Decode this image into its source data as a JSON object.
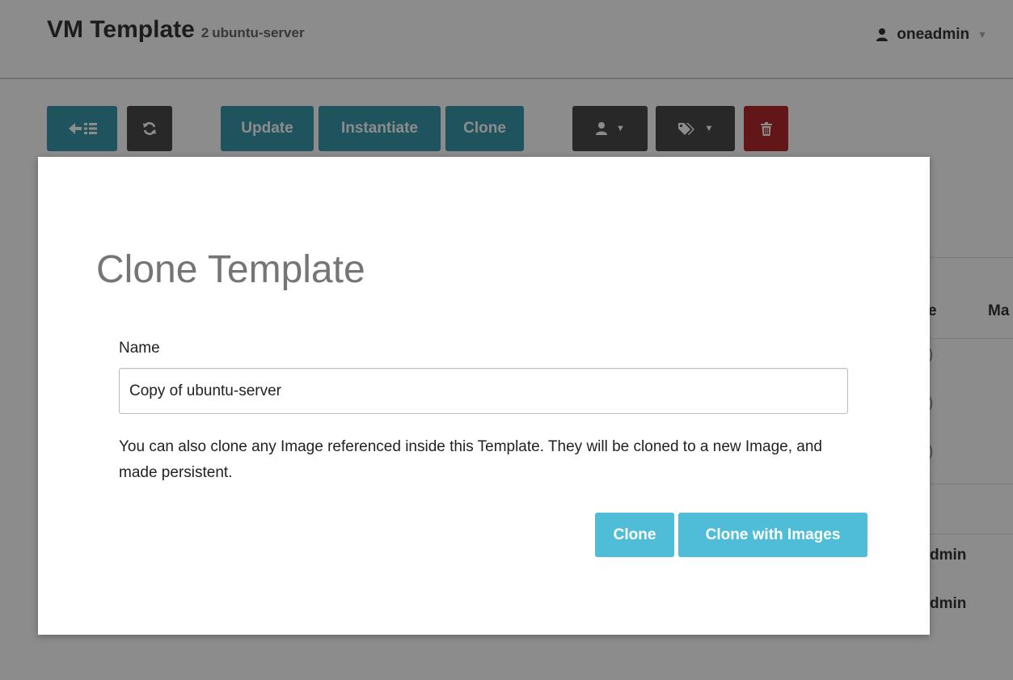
{
  "header": {
    "title": "VM Template",
    "template_id": "2",
    "template_name": "ubuntu-server",
    "user": "oneadmin",
    "user_icon": "user-icon",
    "caret_icon": "caret-down-icon"
  },
  "toolbar": {
    "back_icon": "back-to-list-icon",
    "refresh_icon": "refresh-icon",
    "update_label": "Update",
    "instantiate_label": "Instantiate",
    "clone_label": "Clone",
    "owner_icon": "user-icon",
    "labels_icon": "tags-icon",
    "delete_icon": "trash-icon"
  },
  "background": {
    "col_partial_1": "e",
    "col_partial_2": "Ma",
    "paren": ")",
    "user_partial_1": "dmin",
    "user_partial_2": "dmin"
  },
  "modal": {
    "title": "Clone Template",
    "name_label": "Name",
    "name_value": "Copy of ubuntu-server",
    "help_text": "You can also clone any Image referenced inside this Template. They will be cloned to a new Image, and made persistent.",
    "clone_button": "Clone",
    "clone_with_images_button": "Clone with Images"
  },
  "colors": {
    "teal": "#3a99ac",
    "dark": "#4a4a4a",
    "danger": "#b5282a",
    "modal_button": "#4fbdd8"
  }
}
